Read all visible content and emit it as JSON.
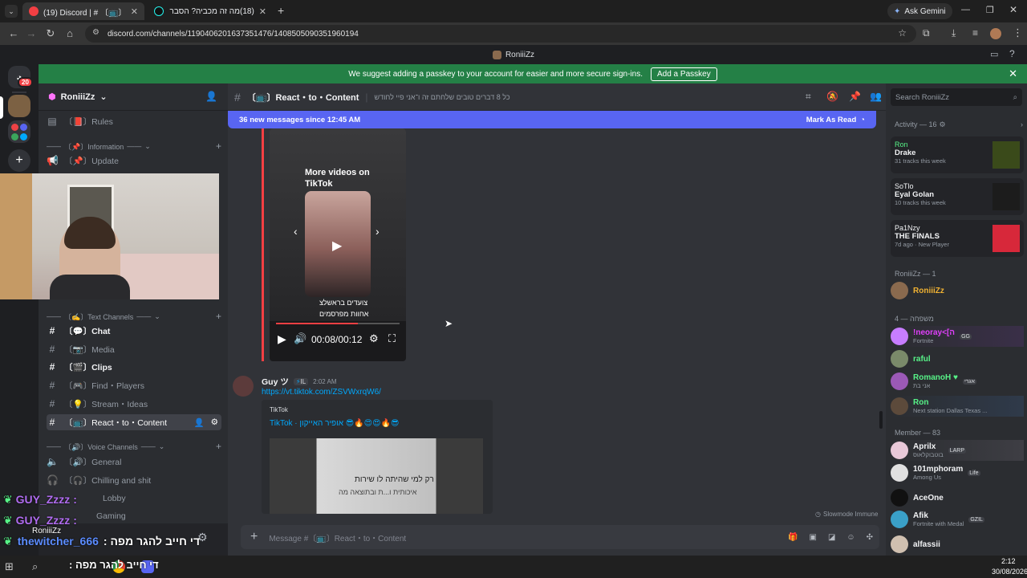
{
  "browser": {
    "tabs": [
      {
        "label": "(19) Discord | # 〔📺〕React・to・",
        "active": true
      },
      {
        "label": "(18)מה זה מכביה? הסבר קצר ע",
        "active": false
      }
    ],
    "url": "discord.com/channels/1190406201637351476/1408505090351960194",
    "ask_gemini": "Ask Gemini"
  },
  "window_title": "RoniiiZz",
  "banner": {
    "text": "We suggest adding a passkey to your account for easier and more secure sign-ins.",
    "button": "Add a Passkey"
  },
  "servers": {
    "badge": "20"
  },
  "sidebar": {
    "server_name": "RoniiiZz",
    "categories": {
      "information": "〔📌〕Information",
      "text": "〔✍️〕Text Channels",
      "voice": "〔🔊〕Voice Channels"
    },
    "channels": {
      "rules": "〔📕〕Rules",
      "update": "〔📌〕Update",
      "chat": "〔💬〕Chat",
      "media": "〔📷〕Media",
      "clips": "〔🎬〕Clips",
      "find_players": "〔🎮〕Find・Players",
      "stream_ideas": "〔💡〕Stream・Ideas",
      "react_content": "〔📺〕React・to・Content",
      "general": "〔🔊〕General",
      "chilling": "〔🎧〕Chilling and shit",
      "lobby": "Lobby",
      "gaming": "Gaming"
    },
    "user": {
      "name": "RoniiiZz"
    }
  },
  "channel_header": {
    "name": "〔📺〕React・to・Content",
    "topic": "כל 8 דברים טובים שלחתם זה ו־אני פיי לחודש"
  },
  "new_messages": {
    "text": "36 new messages since 12:45 AM",
    "action": "Mark As Read"
  },
  "video": {
    "more_videos": "More videos on TikTok",
    "time": "00:08/00:12",
    "caption1": "צועדים בראשלצ",
    "caption2": "אחוות מפרסמים"
  },
  "message": {
    "author": "Guy ツ",
    "tag": "IL",
    "time": "2:02 AM",
    "link": "https://vt.tiktok.com/ZSVWxrqW6/",
    "embed_provider": "TikTok",
    "embed_title": "TikTok · אופיר האייקון 😎🔥😍😍🔥😎",
    "embed_caption1": "רק למי שהיתה לו שירות",
    "embed_caption2": "איכותית ו...ת ובתוצאה מה"
  },
  "slowmode": "Slowmode Immune",
  "composer": {
    "placeholder": "Message #〔📺〕React・to・Content"
  },
  "members": {
    "search": "Search RoniiiZz",
    "activity_header": "Activity — 16",
    "activity": [
      {
        "user": "Ron",
        "title": "Drake",
        "sub": "31 tracks this week"
      },
      {
        "user": "SoTlo",
        "title": "Eyal Golan",
        "sub": "10 tracks this week"
      },
      {
        "user": "Pa1Nzy",
        "title": "THE FINALS",
        "sub": "7d ago · New Player"
      }
    ],
    "owner_group": "RoniiiZz — 1",
    "owner": "RoniiiZz",
    "family_group": "משפחה — 4",
    "family": [
      {
        "name": "!neoray<[ה",
        "sub": "Fortnite",
        "color": "#e040fb",
        "badge": "GG"
      },
      {
        "name": "raful",
        "sub": "",
        "color": "#57f287",
        "badge": ""
      },
      {
        "name": "RomanoH ♥",
        "sub": "אני בת",
        "color": "#57f287",
        "badge": "אגרי"
      },
      {
        "name": "Ron",
        "sub": "Next station Dallas Texas ...",
        "color": "#57f287",
        "badge": ""
      }
    ],
    "member_group": "Member — 83",
    "member_list": [
      {
        "name": "Aprilx",
        "sub": "בוטבוקלאוס",
        "badge": "LARP"
      },
      {
        "name": "101mphoram",
        "sub": "Among Us",
        "badge": "Life"
      },
      {
        "name": "AceOne",
        "sub": "",
        "badge": ""
      },
      {
        "name": "Afik",
        "sub": "Fortnite with Medal",
        "badge": "GZIL"
      },
      {
        "name": "alfassii",
        "sub": "",
        "badge": ""
      }
    ]
  },
  "stream_overlay": {
    "line1": "GUY_Zzzz :",
    "line2": "GUY_Zzzz :",
    "line3_user": "thewitcher_666",
    "line3_msg": "די חייב להגר מפה :",
    "line4": "די חייב להגר מפה :"
  },
  "taskbar": {
    "time": "2:12",
    "date": "30/08/2026"
  },
  "colors": {
    "accent": "#5865f2",
    "banner": "#248046",
    "link": "#00a8fc"
  }
}
